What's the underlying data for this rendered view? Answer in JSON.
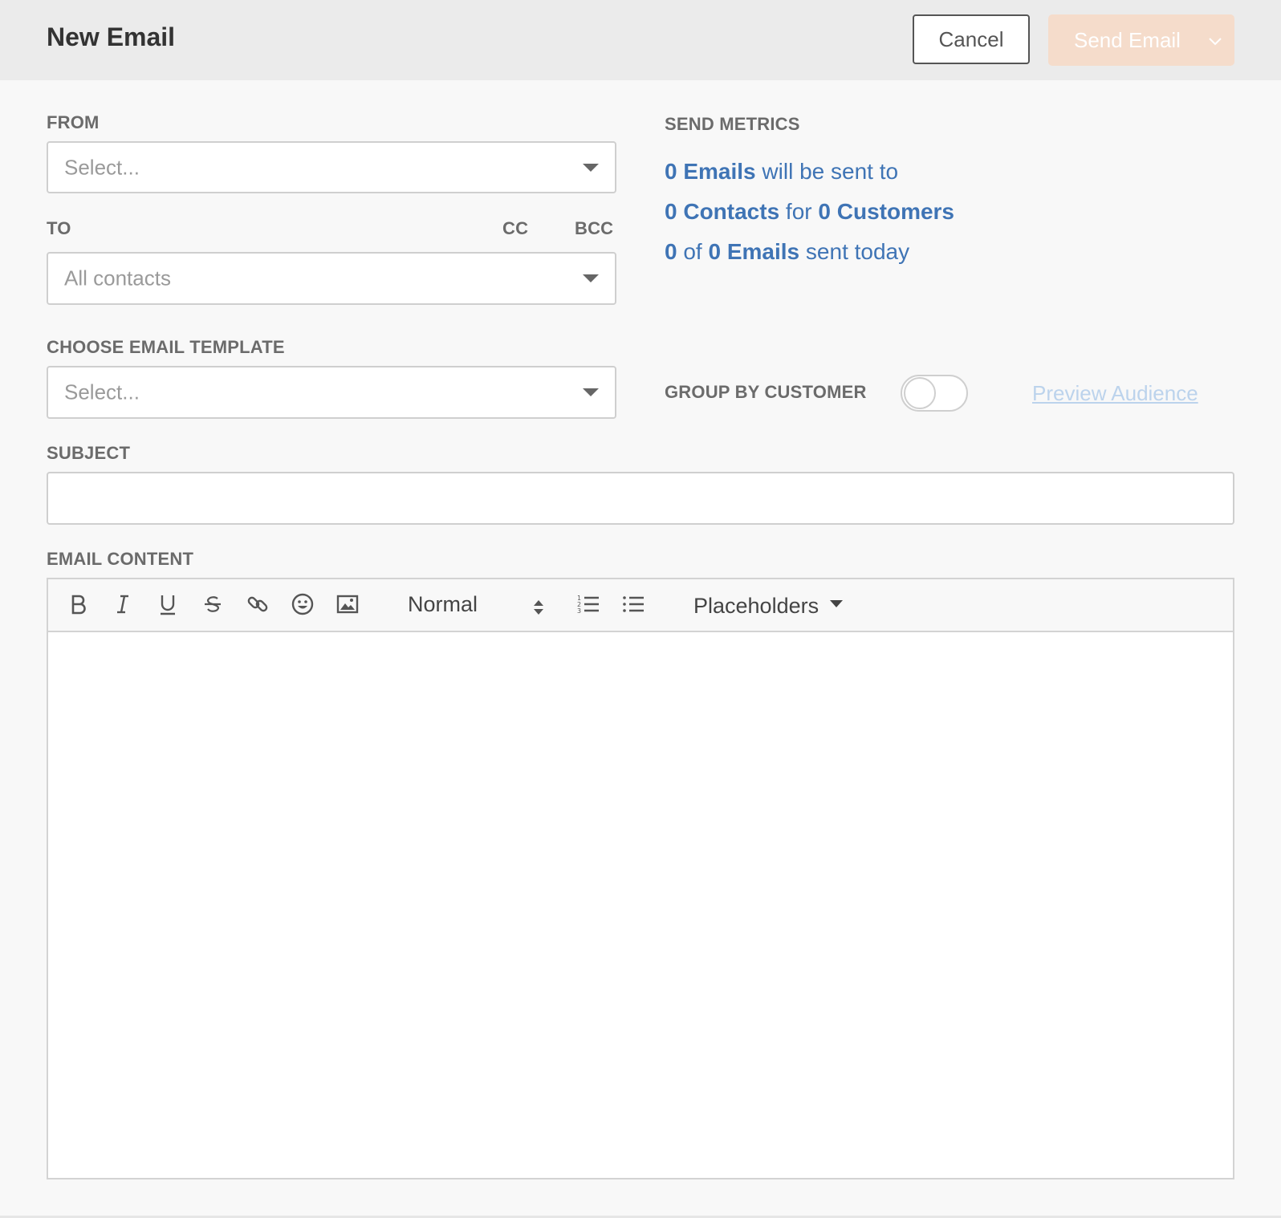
{
  "header": {
    "title": "New Email",
    "cancel_label": "Cancel",
    "send_label": "Send Email"
  },
  "form": {
    "from": {
      "label": "FROM",
      "placeholder": "Select..."
    },
    "to": {
      "label": "TO",
      "cc": "CC",
      "bcc": "BCC",
      "placeholder": "All contacts"
    },
    "template": {
      "label": "CHOOSE EMAIL TEMPLATE",
      "placeholder": "Select..."
    },
    "subject": {
      "label": "SUBJECT",
      "value": ""
    },
    "content": {
      "label": "EMAIL CONTENT",
      "value": ""
    }
  },
  "metrics": {
    "heading": "SEND METRICS",
    "line1": {
      "count": "0 Emails",
      "text": " will be sent to"
    },
    "line2": {
      "contacts": "0 Contacts",
      "mid": " for ",
      "customers": "0 Customers"
    },
    "line3": {
      "sent": "0",
      "mid": " of ",
      "total": "0 Emails",
      "text": " sent today"
    }
  },
  "group_by": {
    "label": "GROUP BY CUSTOMER",
    "on": false
  },
  "preview_link": "Preview Audience",
  "toolbar": {
    "icons": [
      "bold-icon",
      "italic-icon",
      "underline-icon",
      "strikethrough-icon",
      "link-icon",
      "emoji-icon",
      "image-icon",
      "ordered-list-icon",
      "bullet-list-icon"
    ],
    "format_value": "Normal",
    "placeholders_label": "Placeholders"
  },
  "colors": {
    "accent_disabled": "#f5dccb",
    "link_blue": "#3f74b5",
    "link_disabled": "#bcd3ec"
  }
}
